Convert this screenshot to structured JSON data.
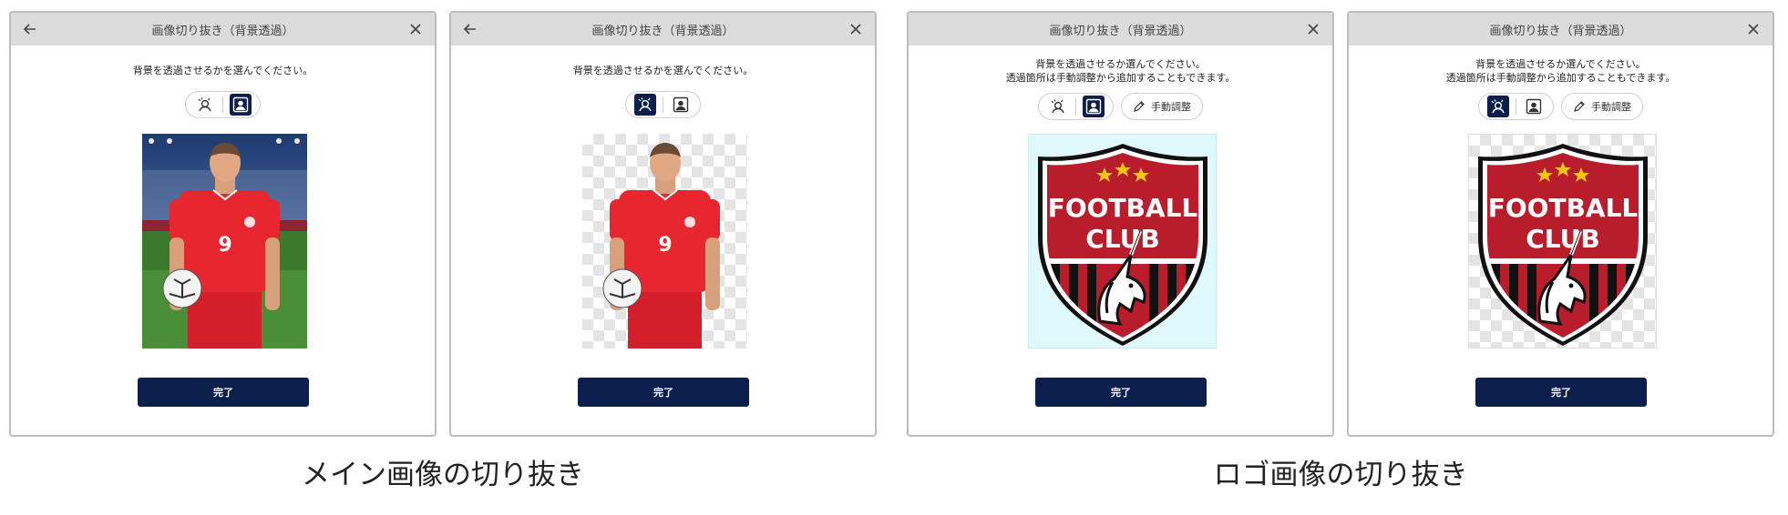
{
  "panels": [
    {
      "title": "画像切り抜き（背景透過）",
      "instruction_line1": "背景を透過させるかを選んでください。",
      "instruction_line2": "",
      "manual_label": "",
      "done_label": "完了"
    },
    {
      "title": "画像切り抜き（背景透過）",
      "instruction_line1": "背景を透過させるかを選んでください。",
      "instruction_line2": "",
      "manual_label": "",
      "done_label": "完了"
    },
    {
      "title": "画像切り抜き（背景透過）",
      "instruction_line1": "背景を透過させるか選んでください。",
      "instruction_line2": "透過箇所は手動調整から追加することもできます。",
      "manual_label": "手動調整",
      "done_label": "完了"
    },
    {
      "title": "画像切り抜き（背景透過）",
      "instruction_line1": "背景を透過させるか選んでください。",
      "instruction_line2": "透過箇所は手動調整から追加することもできます。",
      "manual_label": "手動調整",
      "done_label": "完了"
    }
  ],
  "player_number": "9",
  "logo_text_line1": "FOOTBALL",
  "logo_text_line2": "CLUB",
  "captions": {
    "main": "メイン画像の切り抜き",
    "logo": "ロゴ画像の切り抜き"
  },
  "colors": {
    "accent": "#0c1f4c",
    "jersey": "#e8262f",
    "shield_red": "#b91c2b",
    "logo_bg": "#dff9fc"
  }
}
